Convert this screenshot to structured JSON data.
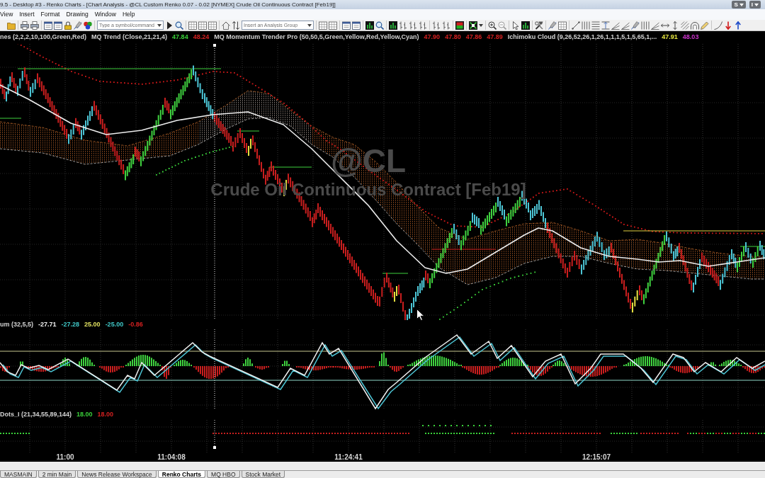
{
  "title_bar": {
    "title": "9.5 - Desktop #3 - Renko Charts - [Chart Analysis - @CL Custom Renko 0.07 - 0.02 [NYMEX] Crude Oil Continuous Contract [Feb19]]",
    "buttons": [
      "S",
      "I"
    ]
  },
  "menu": [
    "View",
    "Insert",
    "Format",
    "Drawing",
    "Window",
    "Help"
  ],
  "toolbar": {
    "symbol_field": {
      "placeholder": "Type a symbol/command"
    },
    "analysis_group_field": {
      "placeholder": "Insert an Analysis Group"
    }
  },
  "chart": {
    "watermark": {
      "symbol": "@CL",
      "description": "Crude Oil Continuous Contract [Feb19]"
    },
    "panes": [
      {
        "kind": "price",
        "studies": [
          {
            "name": "nes (2,2,2,10,100,Green,Red)"
          },
          {
            "name": "MQ Trend (Close,21,21,4)",
            "values": [
              {
                "text": "47.84",
                "color": "#3ad13a"
              },
              {
                "text": "48.24",
                "color": "#d42020"
              }
            ]
          },
          {
            "name": "MQ Momentum Trender Pro (50,50,5,Green,Yellow,Red,Yellow,Cyan)",
            "values": [
              {
                "text": "47.90",
                "color": "#d42020"
              },
              {
                "text": "47.80",
                "color": "#d42020"
              },
              {
                "text": "47.86",
                "color": "#d42020"
              },
              {
                "text": "47.89",
                "color": "#d42020"
              }
            ]
          },
          {
            "name": "Ichimoku Cloud (9,26,52,26,1,26,1,1,1,5,1,5,65,1,...",
            "values": [
              {
                "text": "47.91",
                "color": "#e6e640"
              },
              {
                "text": "48.03",
                "color": "#cc33cc"
              }
            ]
          }
        ]
      },
      {
        "kind": "oscillator",
        "studies": [
          {
            "name": "um (32,5,5)",
            "values": [
              {
                "text": "-27.71",
                "color": "#f2f2f2"
              },
              {
                "text": "-27.28",
                "color": "#40c8c8"
              },
              {
                "text": "25.00",
                "color": "#e0e060"
              },
              {
                "text": "-25.00",
                "color": "#40c8c8"
              },
              {
                "text": "-0.86",
                "color": "#d42020"
              }
            ]
          }
        ]
      },
      {
        "kind": "dots",
        "studies": [
          {
            "name": "Dots_I (21,34,55,89,144)",
            "values": [
              {
                "text": "18.00",
                "color": "#3ad13a"
              },
              {
                "text": "18.00",
                "color": "#d42020"
              }
            ]
          }
        ]
      }
    ],
    "time_axis": [
      "11:00",
      "11:04:08",
      "11:24:41",
      "12:15:07"
    ]
  },
  "workspace_tabs": [
    {
      "label": "MASMAIN",
      "selected": false
    },
    {
      "label": "2 min Main",
      "selected": false
    },
    {
      "label": "News Release Workspace",
      "selected": false
    },
    {
      "label": "Renko Charts",
      "selected": true
    },
    {
      "label": "MQ HBO",
      "selected": false
    },
    {
      "label": "Stock Market",
      "selected": false
    }
  ]
}
